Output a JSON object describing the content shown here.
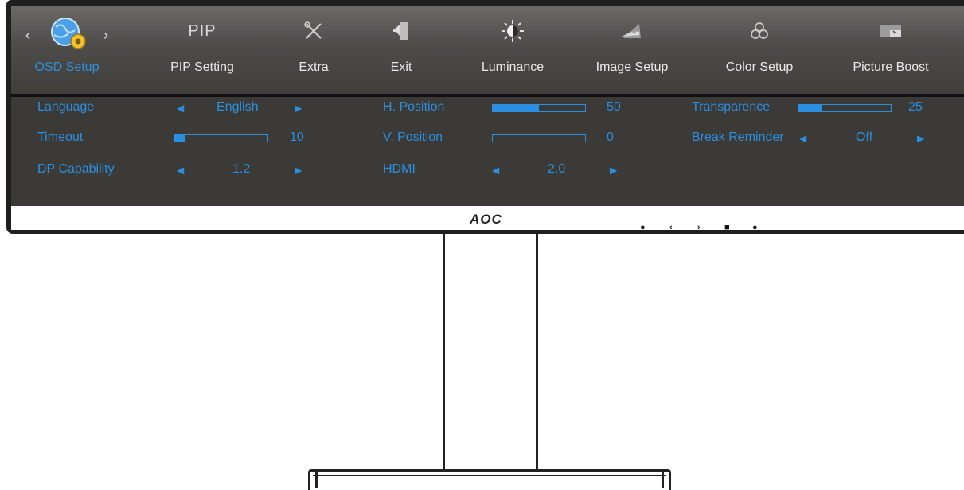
{
  "tabs": [
    {
      "id": "osd-setup",
      "label": "OSD Setup",
      "icon": "globe-gear-icon",
      "active": true
    },
    {
      "id": "pip-setting",
      "label": "PIP Setting",
      "icon": "pip-icon",
      "icon_text": "PIP"
    },
    {
      "id": "extra",
      "label": "Extra",
      "icon": "tools-icon"
    },
    {
      "id": "exit",
      "label": "Exit",
      "icon": "exit-door-icon"
    },
    {
      "id": "luminance",
      "label": "Luminance",
      "icon": "brightness-icon"
    },
    {
      "id": "image-setup",
      "label": "Image Setup",
      "icon": "image-setup-icon"
    },
    {
      "id": "color-setup",
      "label": "Color Setup",
      "icon": "color-circles-icon"
    },
    {
      "id": "picture-boost",
      "label": "Picture Boost",
      "icon": "picture-boost-icon"
    }
  ],
  "settings": {
    "language": {
      "label": "Language",
      "value": "English"
    },
    "timeout": {
      "label": "Timeout",
      "value": "10",
      "level": 0.1
    },
    "dp_capability": {
      "label": "DP Capability",
      "value": "1.2"
    },
    "h_position": {
      "label": "H. Position",
      "value": "50",
      "level": 0.5
    },
    "v_position": {
      "label": "V. Position",
      "value": "0",
      "level": 0.0
    },
    "hdmi": {
      "label": "HDMI",
      "value": "2.0"
    },
    "transparence": {
      "label": "Transparence",
      "value": "25",
      "level": 0.25
    },
    "break_reminder": {
      "label": "Break Reminder",
      "value": "Off"
    }
  },
  "bezel": {
    "logo": "AOC"
  },
  "colors": {
    "accent": "#2a8fe0",
    "osd_bg": "#3b3a37",
    "bezel": "#1f1f1f"
  }
}
